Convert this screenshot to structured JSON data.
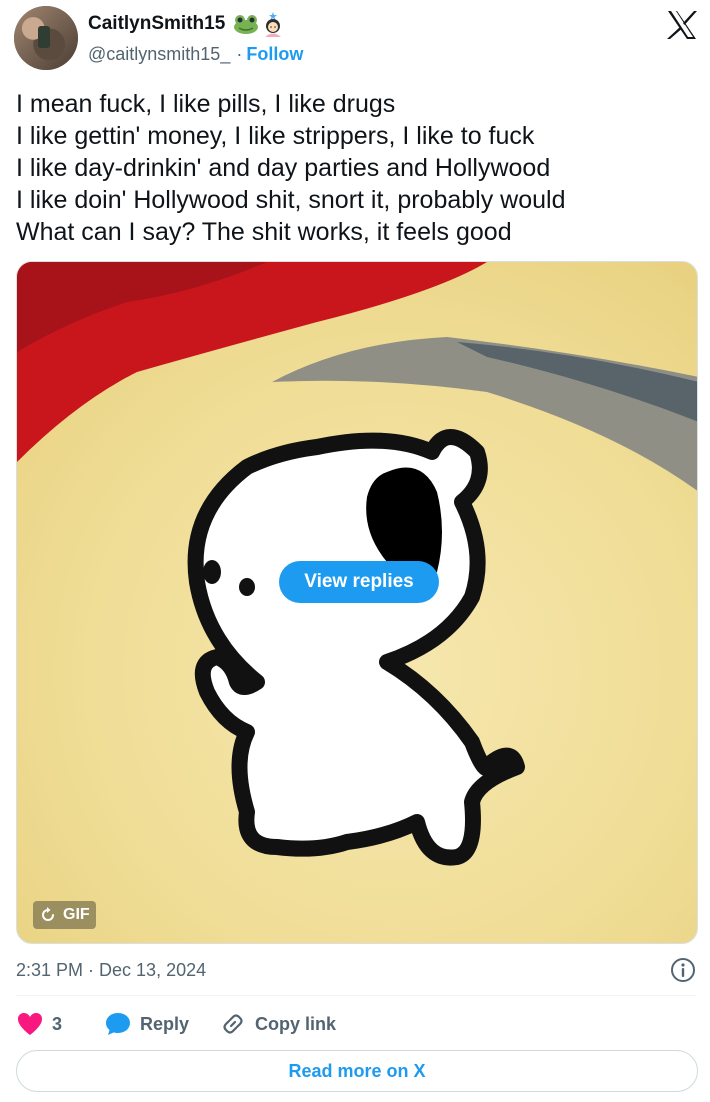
{
  "author": {
    "display_name": "CaitlynSmith15",
    "emoji_1": "frog-emoji",
    "emoji_2": "woman-emoji",
    "handle": "@caitlynsmith15_",
    "separator": "·",
    "follow_label": "Follow"
  },
  "tweet": {
    "lines": [
      "I mean fuck, I like pills, I like drugs",
      "I like gettin' money, I like strippers, I like to fuck",
      "I like day-drinkin' and day parties and Hollywood",
      "I like doin' Hollywood shit, snort it, probably would",
      "What can I say? The shit works, it feels good"
    ]
  },
  "media": {
    "view_replies_label": "View replies",
    "gif_label": "GIF",
    "replay_icon": "replay-icon"
  },
  "meta": {
    "timestamp": "2:31 PM · Dec 13, 2024",
    "info_icon": "info-icon"
  },
  "actions": {
    "like_count": "3",
    "reply_label": "Reply",
    "copy_link_label": "Copy link"
  },
  "footer": {
    "read_more_label": "Read more on X"
  },
  "colors": {
    "accent": "#1d9bf0",
    "like": "#f91880",
    "text_primary": "#0f1419",
    "text_secondary": "#536471"
  }
}
